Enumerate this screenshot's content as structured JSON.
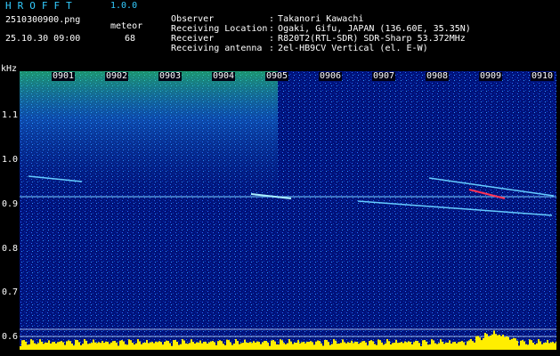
{
  "header": {
    "brand": "HROFFT",
    "version": "1.0.0",
    "filename": "2510300900.png",
    "meteor_label": "meteor",
    "datetime": "25.10.30 09:00",
    "meteor_count": "68"
  },
  "info": [
    {
      "key": "Observer",
      "value": "Takanori Kawachi"
    },
    {
      "key": "Receiving Location",
      "value": "Ogaki, Gifu, JAPAN (136.60E, 35.35N)"
    },
    {
      "key": "Receiver",
      "value": "R820T2(RTL-SDR) SDR-Sharp 53.372MHz"
    },
    {
      "key": "Receiving antenna",
      "value": "2el-HB9CV Vertical (el. E-W)"
    }
  ],
  "plot": {
    "unit": "kHz",
    "y_ticks": [
      "1.1",
      "1.0",
      "0.9",
      "0.8",
      "0.7",
      "0.6"
    ],
    "x_ticks": [
      "0901",
      "0902",
      "0903",
      "0904",
      "0905",
      "0906",
      "0907",
      "0908",
      "0909",
      "0910"
    ],
    "colors": {
      "background": "#001066",
      "signal": "#33ccff",
      "strong": "#ff3355",
      "audio": "#ffee00"
    }
  }
}
